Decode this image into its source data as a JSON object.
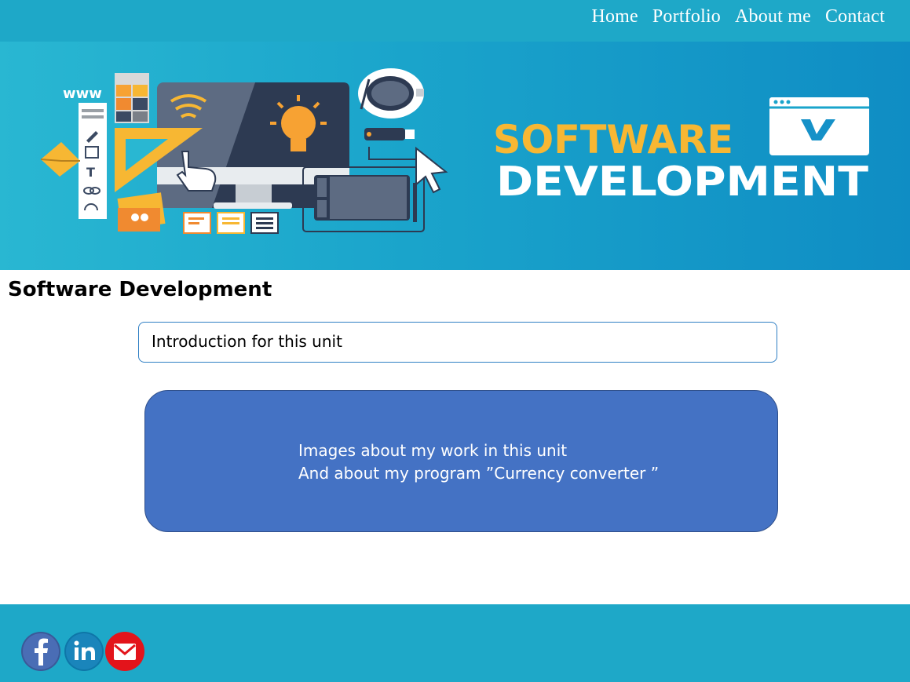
{
  "nav": {
    "items": [
      {
        "label": "Home"
      },
      {
        "label": "Portfolio"
      },
      {
        "label": "About me"
      },
      {
        "label": "Contact"
      }
    ]
  },
  "banner": {
    "line1": "SOFTWARE",
    "line2": "DEVELOPMENT",
    "www": "www",
    "colors": {
      "accent": "#f7b733",
      "bg": "#1aa4cb"
    }
  },
  "page": {
    "title": "Software Development"
  },
  "intro": {
    "text": "Introduction for this unit"
  },
  "images_box": {
    "line1": "Images about my work in this unit",
    "line2": "And about my program ”Currency converter ”"
  },
  "footer": {
    "social": [
      {
        "icon": "facebook-icon",
        "color": "#3b5998"
      },
      {
        "icon": "linkedin-icon",
        "color": "#0e76a8"
      },
      {
        "icon": "email-icon",
        "color": "#e3141b"
      }
    ]
  }
}
